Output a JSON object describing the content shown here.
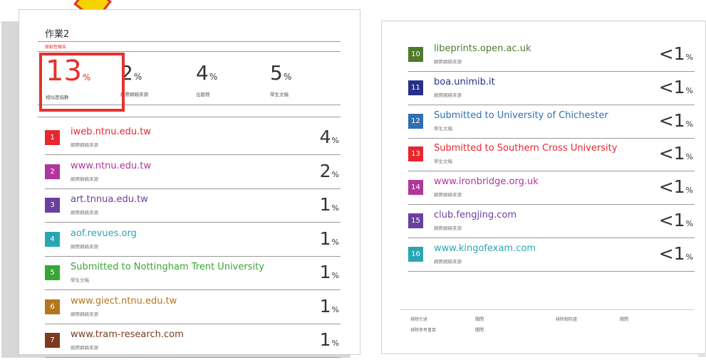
{
  "left_page": {
    "title": "作業2",
    "report_label": "原創性報告",
    "stats": [
      {
        "value": "13",
        "unit": "%",
        "label": "相似度指數"
      },
      {
        "value": "2",
        "unit": "%",
        "label": "網際網絡來源"
      },
      {
        "value": "4",
        "unit": "%",
        "label": "出版物"
      },
      {
        "value": "5",
        "unit": "%",
        "label": "學生文稿"
      }
    ],
    "sources": [
      {
        "num": "1",
        "name": "iweb.ntnu.edu.tw",
        "type": "網際網絡來源",
        "value": "4",
        "unit": "%",
        "color": "#e8262f"
      },
      {
        "num": "2",
        "name": "www.ntnu.edu.tw",
        "type": "網際網絡來源",
        "value": "2",
        "unit": "%",
        "color": "#b0369c"
      },
      {
        "num": "3",
        "name": "art.tnnua.edu.tw",
        "type": "網際網絡來源",
        "value": "1",
        "unit": "%",
        "color": "#6a3fa0"
      },
      {
        "num": "4",
        "name": "aof.revues.org",
        "type": "網際網絡來源",
        "value": "1",
        "unit": "%",
        "color": "#2aa6b3"
      },
      {
        "num": "5",
        "name": "Submitted to Nottingham Trent University",
        "type": "學生文稿",
        "value": "1",
        "unit": "%",
        "color": "#37a635"
      },
      {
        "num": "6",
        "name": "www.giect.ntnu.edu.tw",
        "type": "網際網絡來源",
        "value": "1",
        "unit": "%",
        "color": "#b5761f"
      },
      {
        "num": "7",
        "name": "www.tram-research.com",
        "type": "網際網絡來源",
        "value": "1",
        "unit": "%",
        "color": "#7b3a22"
      }
    ]
  },
  "right_page": {
    "sources": [
      {
        "num": "10",
        "name": "libeprints.open.ac.uk",
        "type": "網際網絡來源",
        "value": "<1",
        "unit": "%",
        "color": "#4f7a2c"
      },
      {
        "num": "11",
        "name": "boa.unimib.it",
        "type": "網際網絡來源",
        "value": "<1",
        "unit": "%",
        "color": "#27308a"
      },
      {
        "num": "12",
        "name": "Submitted to University of Chichester",
        "type": "學生文稿",
        "value": "<1",
        "unit": "%",
        "color": "#2f6fb3"
      },
      {
        "num": "13",
        "name": "Submitted to Southern Cross University",
        "type": "學生文稿",
        "value": "<1",
        "unit": "%",
        "color": "#e8262f"
      },
      {
        "num": "14",
        "name": "www.ironbridge.org.uk",
        "type": "網際網絡來源",
        "value": "<1",
        "unit": "%",
        "color": "#b0369c"
      },
      {
        "num": "15",
        "name": "club.fengjing.com",
        "type": "網際網絡來源",
        "value": "<1",
        "unit": "%",
        "color": "#6a3fa0"
      },
      {
        "num": "16",
        "name": "www.kingofexam.com",
        "type": "網際網絡來源",
        "value": "<1",
        "unit": "%",
        "color": "#2aa6b3"
      }
    ],
    "footer": {
      "exclude_quotes_label": "排除引述",
      "exclude_quotes_value": "關閉",
      "exclude_bibliography_label": "排除參考書目",
      "exclude_bibliography_value": "關閉",
      "exclude_matches_label": "排除相符處",
      "exclude_matches_value": "關閉"
    }
  },
  "colors": {
    "accent_red": "#e4322b"
  }
}
